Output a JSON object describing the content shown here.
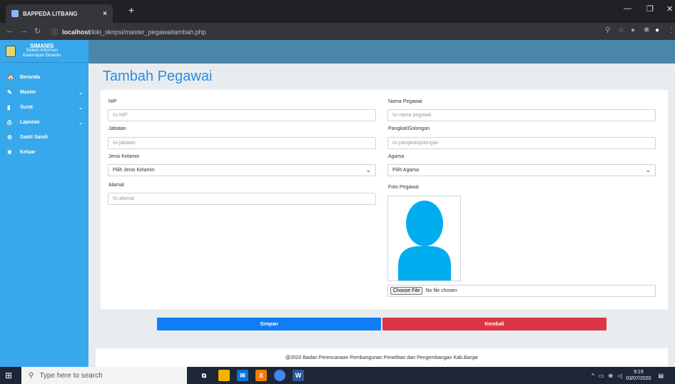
{
  "browser": {
    "tab_title": "BAPPEDA LITBANG",
    "tab_close": "×",
    "new_tab": "+",
    "url_host": "localhost",
    "url_path": "/kiki_skripsi/master_pegawaitambah.php"
  },
  "sidebar": {
    "brand_title": "SIMANIS",
    "brand_sub1": "Sistem Informasi",
    "brand_sub2": "Keamsipan Dinamis",
    "items": [
      {
        "label": "Beranda",
        "icon": "home-icon",
        "glyph": "🏠",
        "has_chevron": false
      },
      {
        "label": "Master",
        "icon": "pencil-icon",
        "glyph": "✎",
        "has_chevron": true
      },
      {
        "label": "Surat",
        "icon": "book-icon",
        "glyph": "▮",
        "has_chevron": true
      },
      {
        "label": "Laporan",
        "icon": "print-icon",
        "glyph": "⎙",
        "has_chevron": true
      },
      {
        "label": "Ganti Sandi",
        "icon": "gear-icon",
        "glyph": "⚙",
        "has_chevron": false
      },
      {
        "label": "Keluar",
        "icon": "close-icon",
        "glyph": "✖",
        "has_chevron": false
      }
    ]
  },
  "page": {
    "title": "Tambah Pegawai"
  },
  "form": {
    "nip": {
      "label": "NIP",
      "placeholder": "Isi NIP"
    },
    "nama": {
      "label": "Nama Pegawai",
      "placeholder": "Isi nama pegawai"
    },
    "jabatan": {
      "label": "Jabatan",
      "placeholder": "Isi jabatan"
    },
    "pangkat": {
      "label": "Pangkat/Golongan",
      "placeholder": "Isi pangkat/golongan"
    },
    "jenis_kelamin": {
      "label": "Jenis Kelamin",
      "selected": "Pilih Jenis Kelamin"
    },
    "agama": {
      "label": "Agama",
      "selected": "Pilih Agama"
    },
    "alamat": {
      "label": "Alamat",
      "placeholder": "Isi alamat"
    },
    "foto": {
      "label": "Foto Pegawai",
      "button": "Choose File",
      "status": "No file chosen"
    }
  },
  "buttons": {
    "save": "Simpan",
    "back": "Kembali"
  },
  "footer": {
    "text": "@2020 Badan Perencanaan Pembangunan Penelitian dan Pengembangan Kab.Banjar"
  },
  "taskbar": {
    "search_placeholder": "Type here to search",
    "time": "9:19",
    "date": "03/07/2020"
  },
  "colors": {
    "sidebar": "#38a8ec",
    "header_strip": "#4a86a8",
    "title": "#2a8ee0",
    "save": "#0d7ef5",
    "back": "#dc3545",
    "avatar": "#00aeef"
  }
}
